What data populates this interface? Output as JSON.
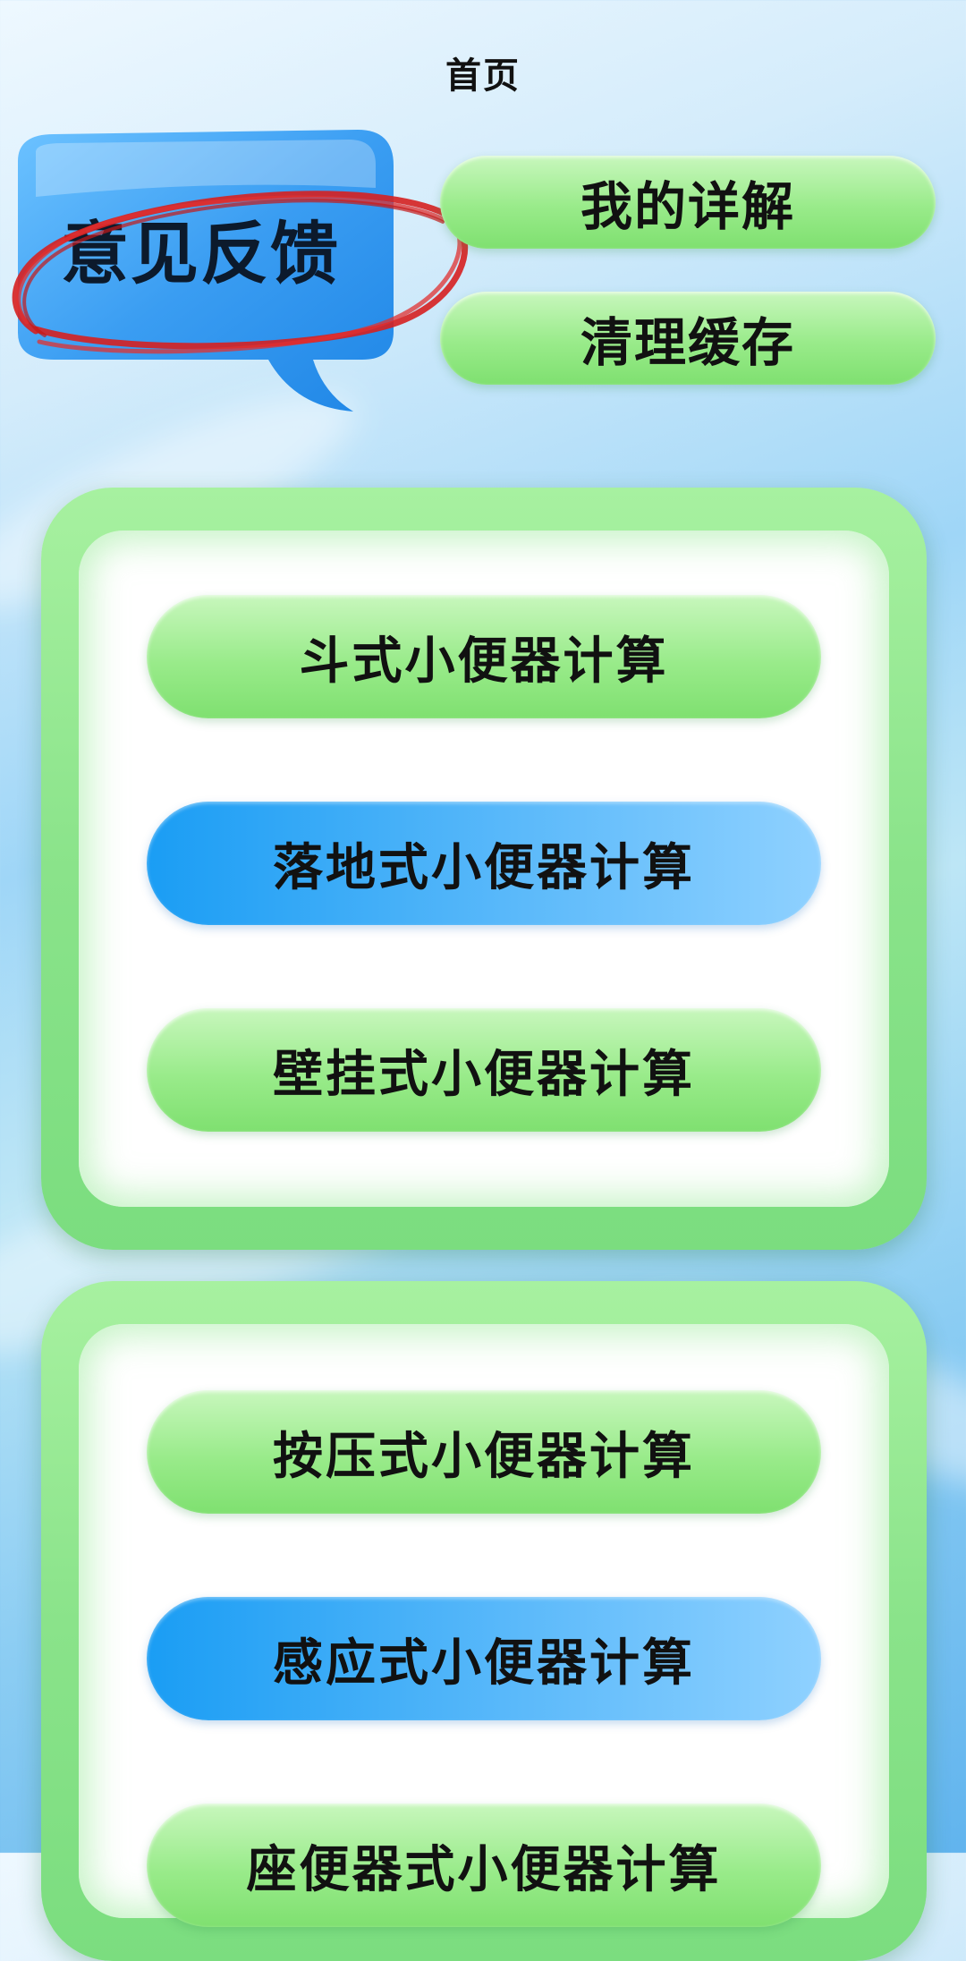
{
  "header": {
    "title": "首页"
  },
  "feedback": {
    "label": "意见反馈"
  },
  "top_actions": {
    "my_details": "我的详解",
    "clear_cache": "清理缓存"
  },
  "panel_1": {
    "items": [
      {
        "label": "斗式小便器计算",
        "style": "green"
      },
      {
        "label": "落地式小便器计算",
        "style": "blue"
      },
      {
        "label": "壁挂式小便器计算",
        "style": "green"
      }
    ]
  },
  "panel_2": {
    "items": [
      {
        "label": "按压式小便器计算",
        "style": "green"
      },
      {
        "label": "感应式小便器计算",
        "style": "blue"
      },
      {
        "label": "座便器式小便器计算",
        "style": "green"
      }
    ]
  },
  "colors": {
    "green_button": "#99eb8a",
    "blue_button": "#4fb4f9",
    "panel_frame": "#8ae38a",
    "feedback_bubble": "#3a9df2",
    "annotation_circle": "#d62020"
  }
}
